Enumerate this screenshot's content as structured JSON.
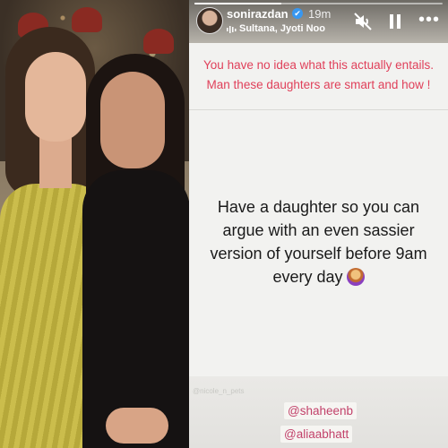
{
  "header": {
    "username": "sonirazdan",
    "verified_badge": "✔",
    "time": "19m",
    "music": "Sultana, Jyoti Noo",
    "more_label": "•••",
    "progress": 0.35
  },
  "icons": {
    "music": "music-note-icon",
    "mute": "speaker-muted-icon",
    "pause": "pause-icon",
    "more": "more-dots-icon"
  },
  "caption": {
    "line1": "You have no idea what this actually entails.",
    "line2": "Man these daughters are smart and how !"
  },
  "quote": {
    "text": "Have a daughter so you can argue with an even sassier version of yourself before 9am every day",
    "emoji": "woman-tipping-hand-emoji"
  },
  "watermark": "@nicole_n_pets",
  "mentions": [
    "@shaheenb",
    "@aliaabhatt"
  ],
  "colors": {
    "caption": "#e0405a",
    "mention": "#c2416a",
    "verified": "#3897f0"
  }
}
